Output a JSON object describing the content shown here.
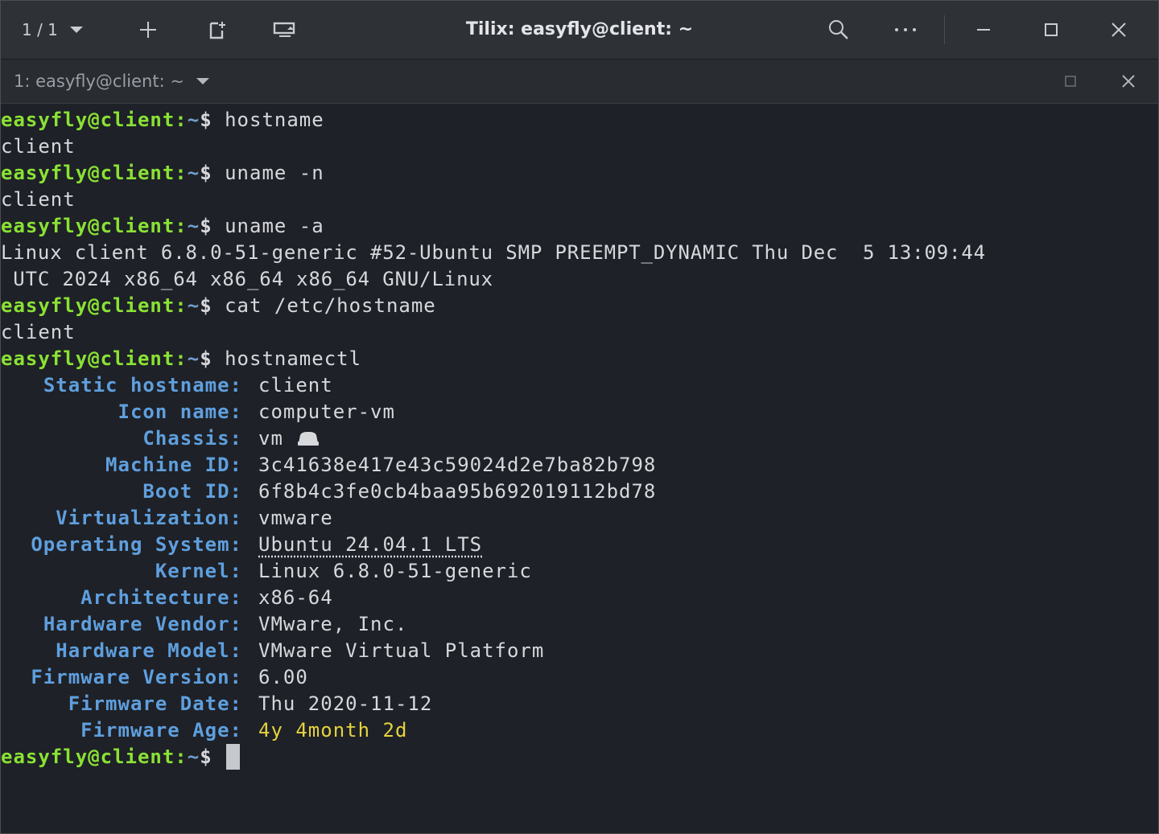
{
  "titlebar": {
    "session_counter": "1 / 1",
    "title": "Tilix: easyfly@client: ~",
    "icons": [
      "chevron-down-icon",
      "plus-icon",
      "new-session-icon",
      "sync-input-icon",
      "search-icon",
      "more-icon",
      "minimize-icon",
      "maximize-icon",
      "close-icon"
    ]
  },
  "tab": {
    "title": "1: easyfly@client: ~"
  },
  "prompt": {
    "user": "easyfly@client",
    "sep": ":",
    "path": "~",
    "dollar": "$"
  },
  "commands": {
    "c1": "hostname",
    "o1": "client",
    "c2": "uname -n",
    "o2": "client",
    "c3": "uname -a",
    "o3a": "Linux client 6.8.0-51-generic #52-Ubuntu SMP PREEMPT_DYNAMIC Thu Dec  5 13:09:44",
    "o3b": " UTC 2024 x86_64 x86_64 x86_64 GNU/Linux",
    "c4": "cat /etc/hostname",
    "o4": "client",
    "c5": "hostnamectl"
  },
  "hostnamectl": [
    {
      "key": "Static hostname:",
      "value": "client"
    },
    {
      "key": "Icon name:",
      "value": "computer-vm"
    },
    {
      "key": "Chassis:",
      "value": "vm"
    },
    {
      "key": "Machine ID:",
      "value": "3c41638e417e43c59024d2e7ba82b798"
    },
    {
      "key": "Boot ID:",
      "value": "6f8b4c3fe0cb4baa95b692019112bd78"
    },
    {
      "key": "Virtualization:",
      "value": "vmware"
    },
    {
      "key": "Operating System:",
      "value": "Ubuntu 24.04.1 LTS"
    },
    {
      "key": "Kernel:",
      "value": "Linux 6.8.0-51-generic"
    },
    {
      "key": "Architecture:",
      "value": "x86-64"
    },
    {
      "key": "Hardware Vendor:",
      "value": "VMware, Inc."
    },
    {
      "key": "Hardware Model:",
      "value": "VMware Virtual Platform"
    },
    {
      "key": "Firmware Version:",
      "value": "6.00"
    },
    {
      "key": "Firmware Date:",
      "value": "Thu 2020-11-12"
    },
    {
      "key": "Firmware Age:",
      "value": "4y 4month 2d"
    }
  ],
  "colors": {
    "prompt_user": "#8ae234",
    "prompt_path": "#729fcf",
    "key": "#5f9fde",
    "firmware_age": "#e5d23f"
  }
}
